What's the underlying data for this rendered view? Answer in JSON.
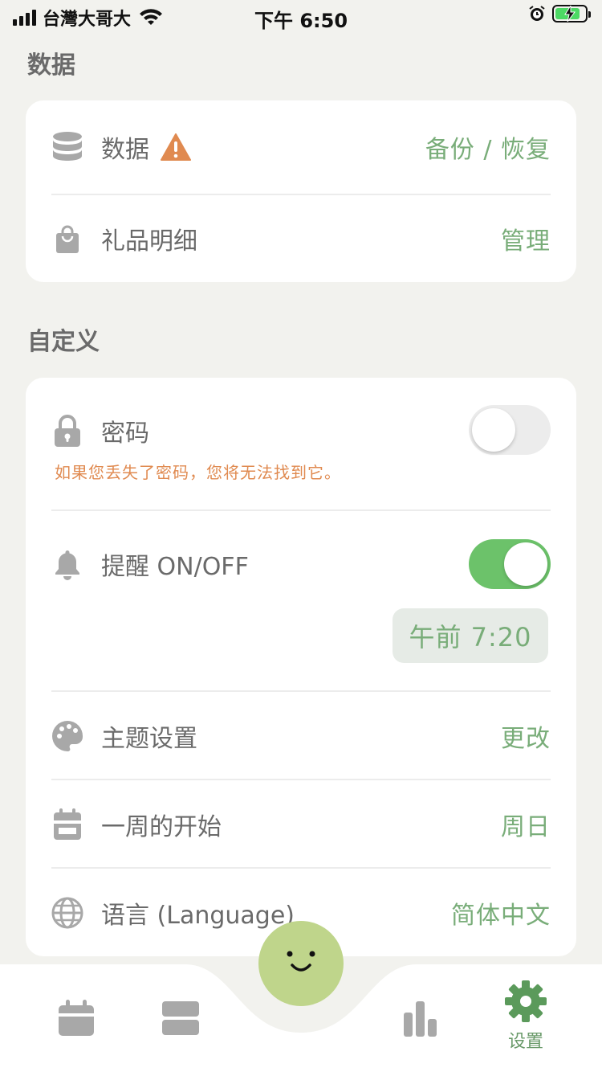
{
  "status_bar": {
    "carrier": "台灣大哥大",
    "time": "下午 6:50"
  },
  "sections": {
    "data_title": "数据",
    "custom_title": "自定义"
  },
  "data_card": {
    "backup": {
      "label": "数据",
      "value": "备份 / 恢复"
    },
    "gifts": {
      "label": "礼品明细",
      "value": "管理"
    }
  },
  "custom_card": {
    "password": {
      "label": "密码",
      "note": "如果您丢失了密码，您将无法找到它。",
      "enabled": false
    },
    "reminder": {
      "label": "提醒 ON/OFF",
      "enabled": true,
      "time": "午前 7:20"
    },
    "theme": {
      "label": "主题设置",
      "value": "更改"
    },
    "week_start": {
      "label": "一周的开始",
      "value": "周日"
    },
    "language": {
      "label": "语言 (Language)",
      "value": "简体中文"
    }
  },
  "tabbar": {
    "settings_label": "设置"
  },
  "colors": {
    "accent": "#79ad79",
    "warning": "#e08a50",
    "toggle_on": "#6cc26a",
    "fab": "#bfd58b"
  }
}
